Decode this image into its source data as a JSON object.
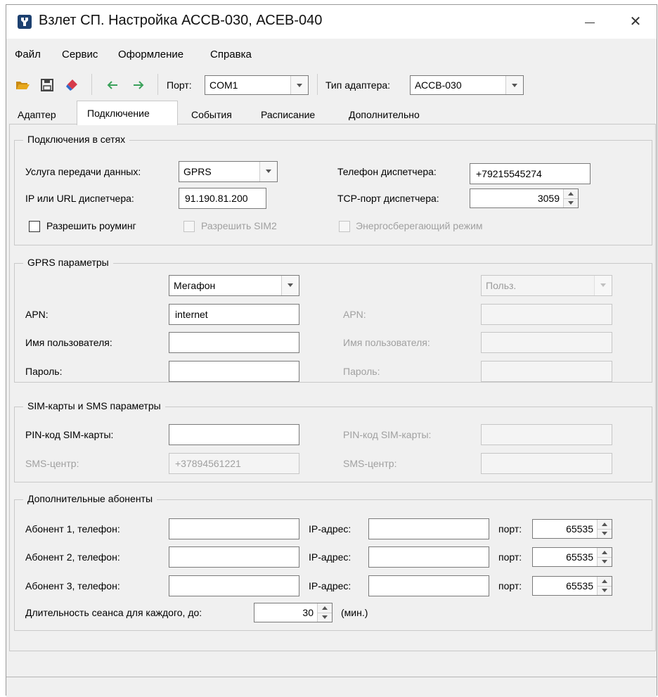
{
  "window": {
    "title": "Взлет СП. Настройка АССВ-030, АСЕВ-040",
    "close_glyph": "✕"
  },
  "menu": [
    "Файл",
    "Сервис",
    "Оформление",
    "Справка"
  ],
  "toolbar": {
    "port_label": "Порт:",
    "port_value": "COM1",
    "adapter_type_label": "Тип адаптера:",
    "adapter_type_value": "АССВ-030"
  },
  "tabs": [
    "Адаптер",
    "Подключение",
    "События",
    "Расписание",
    "Дополнительно"
  ],
  "active_tab": "Подключение",
  "network": {
    "title": "Подключения в сетях",
    "service_label": "Услуга передачи данных:",
    "service_value": "GPRS",
    "dispatcher_phone_label": "Телефон диспетчера:",
    "dispatcher_phone_value": "+79215545274",
    "dispatcher_ip_label": "IP или URL диспетчера:",
    "dispatcher_ip_value": "91.190.81.200",
    "tcp_port_label": "TCP-порт диспетчера:",
    "tcp_port_value": "3059",
    "roaming_label": "Разрешить роуминг",
    "sim2_label": "Разрешить SIM2",
    "powersave_label": "Энергосберегающий режим"
  },
  "gprs": {
    "title": "GPRS параметры",
    "operator1_value": "Мегафон",
    "operator2_value": "Польз.",
    "apn_label": "APN:",
    "apn1_value": "internet",
    "user_label": "Имя пользователя:",
    "password_label": "Пароль:"
  },
  "sim": {
    "title": "SIM-карты и SMS параметры",
    "pin_label": "PIN-код SIM-карты:",
    "sms_center_label": "SMS-центр:",
    "sms_center1_value": "+37894561221"
  },
  "subscribers": {
    "title": "Дополнительные абоненты",
    "rows": [
      {
        "label": "Абонент 1, телефон:",
        "ip_label": "IP-адрес:",
        "port_label": "порт:",
        "port_value": "65535"
      },
      {
        "label": "Абонент 2, телефон:",
        "ip_label": "IP-адрес:",
        "port_label": "порт:",
        "port_value": "65535"
      },
      {
        "label": "Абонент 3, телефон:",
        "ip_label": "IP-адрес:",
        "port_label": "порт:",
        "port_value": "65535"
      }
    ],
    "duration_label": "Длительность сеанса для каждого, до:",
    "duration_value": "30",
    "duration_unit": "(мин.)"
  },
  "icons": {
    "app": "key-icon",
    "open": "folder-open-icon",
    "save": "save-icon",
    "erase": "eraser-icon",
    "back": "arrow-left-icon",
    "forward": "arrow-right-icon"
  },
  "colors": {
    "app_icon_bg": "#1d4170",
    "folder": "#e7a81d",
    "eraser": "#d63a4a",
    "arrows": "#3aa15a"
  }
}
